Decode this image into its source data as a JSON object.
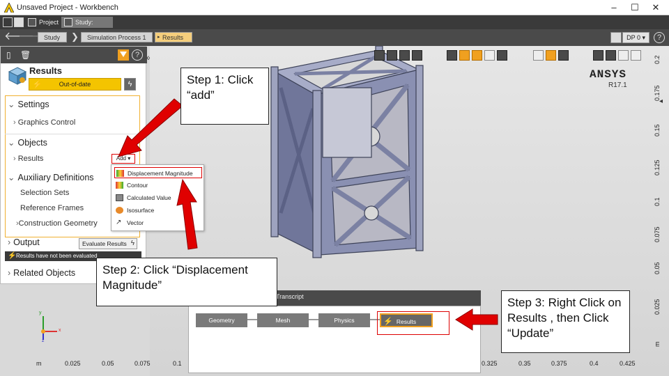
{
  "window": {
    "title": "Unsaved Project - Workbench"
  },
  "tabs": [
    {
      "label": "Project"
    },
    {
      "label": "Study: Results"
    }
  ],
  "breadcrumb": [
    "Study",
    "Simulation Process 1",
    "Results"
  ],
  "design_point": "DP 0 ▾",
  "panel": {
    "title": "Results",
    "status": "Out-of-date",
    "sections": {
      "settings": "Settings",
      "graphics_control": "Graphics Control",
      "objects": "Objects",
      "results": "Results",
      "add": "Add ▾",
      "aux": "Auxiliary Definitions",
      "selection_sets": "Selection Sets",
      "reference_frames": "Reference Frames",
      "construction_geometry": "Construction Geometry",
      "output": "Output",
      "evaluate": "Evaluate Results",
      "warning": "Results have not been evaluated",
      "related": "Related Objects"
    }
  },
  "dropdown": [
    "Displacement Magnitude",
    "Contour",
    "Calculated Value",
    "Isosurface",
    "Vector"
  ],
  "viewport": {
    "brand": "ANSYS",
    "version": "R17.1",
    "vticks": [
      "0.2",
      "0.175",
      "0.15",
      "0.125",
      "0.1",
      "0.075",
      "0.05",
      "0.025",
      "m"
    ],
    "hticks": [
      "m",
      "0.025",
      "0.05",
      "0.075",
      "0.1",
      "0.325",
      "0.35",
      "0.375",
      "0.4",
      "0.425"
    ],
    "axis_x": "x",
    "axis_y": "y",
    "axis_z": "z"
  },
  "workflow": {
    "tab": "Transcript",
    "nodes": [
      "Geometry",
      "Mesh",
      "Physics",
      "Results"
    ]
  },
  "callouts": {
    "step1": "Step 1: Click “add”",
    "step2": "Step 2: Click “Displacement Magnitude”",
    "step3": "Step 3: Right Click on Results , then Click “Update”"
  },
  "colors": {
    "accent": "#f0a020",
    "status": "#f4c400",
    "arrow": "#e00000"
  }
}
